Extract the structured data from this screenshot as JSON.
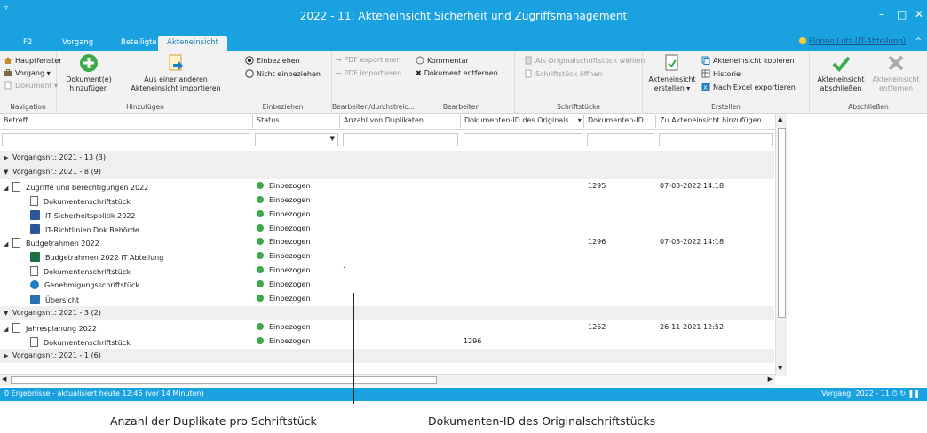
{
  "window": {
    "title": "2022 - 11: Akteneinsicht Sicherheit und Zugriffsmanagement",
    "sysmenu": "▿",
    "controls": [
      "–",
      "□",
      "✕"
    ]
  },
  "ribbon_tabs": [
    {
      "label": "F2"
    },
    {
      "label": "Vorgang"
    },
    {
      "label": "Beteiligte"
    },
    {
      "label": "Akteneinsicht",
      "active": true
    }
  ],
  "user": {
    "name": "Florian Lutz (IT-Abteilung)"
  },
  "collapse_icon": "^",
  "groups": {
    "navigation": {
      "label": "Navigation",
      "items": [
        "Hauptfenster",
        "Vorgang ▾",
        "Dokument ▾"
      ]
    },
    "hinzufuegen": {
      "label": "Hinzufügen",
      "btn1": [
        "Dokument(e)",
        "hinzufügen"
      ],
      "btn2": [
        "Aus einer anderen",
        "Akteneinsicht importieren"
      ]
    },
    "einbeziehen": {
      "label": "Einbeziehen",
      "opt1": "Einbeziehen",
      "opt2": "Nicht einbeziehen"
    },
    "bearbeiten_durch": {
      "label": "Bearbeiten/durchstreic...",
      "items": [
        "PDF exportieren",
        "PDF importieren"
      ]
    },
    "bearbeiten": {
      "label": "Bearbeiten",
      "items": [
        "Kommentar",
        "Dokument entfernen"
      ]
    },
    "schriftstuecke": {
      "label": "Schriftstücke",
      "items": [
        "Als Originalschriftstück wählen",
        "Schriftstück öffnen"
      ]
    },
    "erstellen": {
      "label": "Erstellen",
      "big": [
        "Akteneinsicht",
        "erstellen ▾"
      ],
      "items": [
        "Akteneinsicht kopieren",
        "Historie",
        "Nach Excel exportieren"
      ]
    },
    "abschliessen": {
      "label": "Abschließen",
      "btn1": [
        "Akteneinsicht",
        "abschließen"
      ],
      "btn2": [
        "Akteneinsicht",
        "entfernen"
      ]
    }
  },
  "columns": [
    {
      "label": "Betreff"
    },
    {
      "label": "Status"
    },
    {
      "label": "Anzahl von Duplikaten"
    },
    {
      "label": "Dokumenten-ID des Originals... ▾"
    },
    {
      "label": "Dokumenten-ID"
    },
    {
      "label": "Zu Akteneinsicht hinzufügen"
    }
  ],
  "rows": [
    {
      "kind": "group",
      "collapsed": true,
      "label": "Vorgangsnr.: 2021 - 13 (3)"
    },
    {
      "kind": "group",
      "collapsed": false,
      "label": "Vorgangsnr.: 2021 - 8 (9)"
    },
    {
      "kind": "parent",
      "icon": "doc",
      "betreff": "Zugriffe und Berechtigungen 2022",
      "status": "Einbezogen",
      "dup": "",
      "orig": "",
      "docid": "1295",
      "added": "07-03-2022 14:18"
    },
    {
      "kind": "child",
      "icon": "doc",
      "betreff": "Dokumentenschriftstück",
      "status": "Einbezogen",
      "dup": "",
      "orig": "",
      "docid": "",
      "added": ""
    },
    {
      "kind": "child",
      "icon": "word",
      "betreff": "IT Sicherheitspolitik 2022",
      "status": "Einbezogen",
      "dup": "",
      "orig": "",
      "docid": "",
      "added": ""
    },
    {
      "kind": "child",
      "icon": "word",
      "betreff": "IT-Richtlinien Dok Behörde",
      "status": "Einbezogen",
      "dup": "",
      "orig": "",
      "docid": "",
      "added": ""
    },
    {
      "kind": "parent",
      "icon": "doc",
      "betreff": "Budgetrahmen 2022",
      "status": "Einbezogen",
      "dup": "",
      "orig": "",
      "docid": "1296",
      "added": "07-03-2022 14:18"
    },
    {
      "kind": "child",
      "icon": "excel",
      "betreff": "Budgetrahmen 2022 IT Abteilung",
      "status": "Einbezogen",
      "dup": "",
      "orig": "",
      "docid": "",
      "added": ""
    },
    {
      "kind": "child",
      "icon": "doc",
      "betreff": "Dokumentenschriftstück",
      "status": "Einbezogen",
      "dup": "1",
      "orig": "",
      "docid": "",
      "added": ""
    },
    {
      "kind": "child",
      "icon": "check",
      "betreff": "Genehmigungsschriftstück",
      "status": "Einbezogen",
      "dup": "",
      "orig": "",
      "docid": "",
      "added": ""
    },
    {
      "kind": "child",
      "icon": "ppt",
      "betreff": "Übersicht",
      "status": "Einbezogen",
      "dup": "",
      "orig": "",
      "docid": "",
      "added": ""
    },
    {
      "kind": "group",
      "collapsed": false,
      "label": "Vorgangsnr.: 2021 - 3 (2)"
    },
    {
      "kind": "parent",
      "icon": "doc",
      "betreff": "Jahresplanung 2022",
      "status": "Einbezogen",
      "dup": "",
      "orig": "",
      "docid": "1262",
      "added": "26-11-2021 12:52"
    },
    {
      "kind": "child",
      "icon": "doc",
      "betreff": "Dokumentenschriftstück",
      "status": "Einbezogen",
      "dup": "",
      "orig": "1296",
      "docid": "",
      "added": ""
    },
    {
      "kind": "group",
      "collapsed": true,
      "label": "Vorgangsnr.: 2021 - 1 (6)"
    }
  ],
  "status_bar": {
    "left": "0 Ergebnisse - aktualisiert heute 12:45 (vor 14 Minuten)",
    "right": "Vorgang: 2022 - 11"
  },
  "callouts": {
    "dup": "Anzahl der Duplikate pro Schriftstück",
    "orig": "Dokumenten-ID des Originalschriftstücks"
  },
  "colors": {
    "accent": "#1aa2e0",
    "status_green": "#3aaa4a"
  }
}
